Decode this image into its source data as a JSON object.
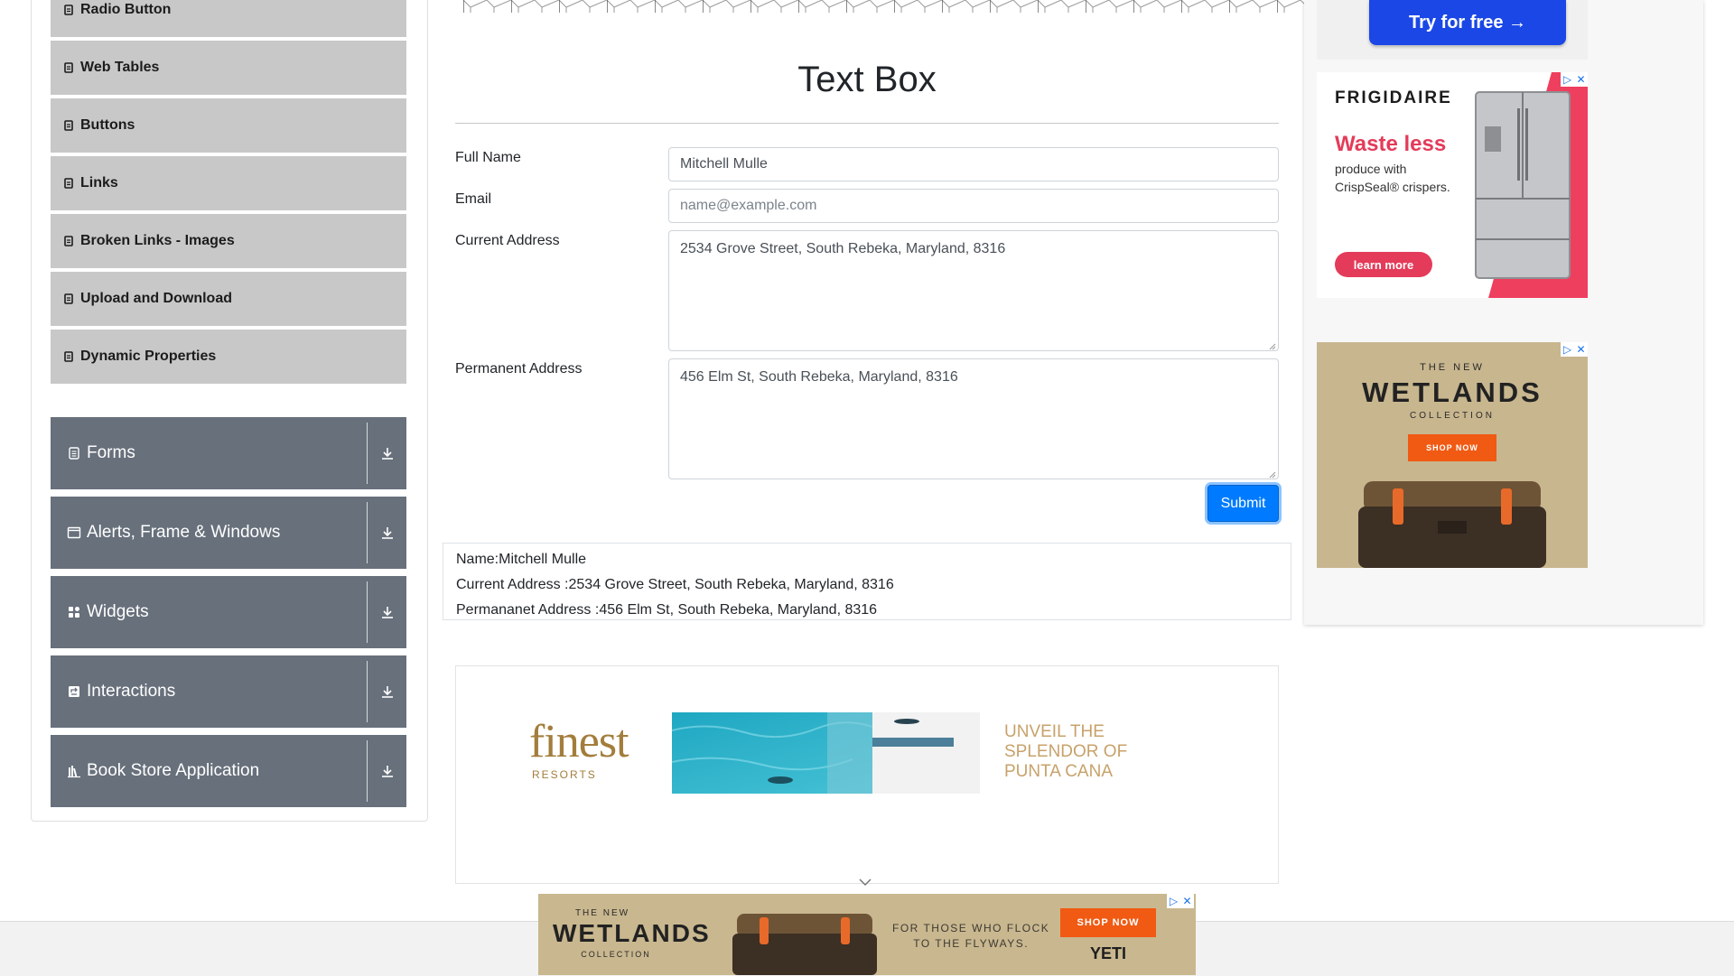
{
  "sidebar": {
    "sub_items": [
      {
        "label": "Radio Button"
      },
      {
        "label": "Web Tables"
      },
      {
        "label": "Buttons"
      },
      {
        "label": "Links"
      },
      {
        "label": "Broken Links - Images"
      },
      {
        "label": "Upload and Download"
      },
      {
        "label": "Dynamic Properties"
      }
    ],
    "groups": [
      {
        "label": "Forms",
        "icon": "form-icon"
      },
      {
        "label": "Alerts, Frame & Windows",
        "icon": "window-icon"
      },
      {
        "label": "Widgets",
        "icon": "widgets-icon"
      },
      {
        "label": "Interactions",
        "icon": "interactions-icon"
      },
      {
        "label": "Book Store Application",
        "icon": "books-icon"
      }
    ]
  },
  "main": {
    "title": "Text Box",
    "fields": {
      "full_name": {
        "label": "Full Name",
        "value": "Mitchell Mulle"
      },
      "email": {
        "label": "Email",
        "value": "",
        "placeholder": "name@example.com"
      },
      "current_address": {
        "label": "Current Address",
        "value": "2534 Grove Street, South Rebeka, Maryland, 8316"
      },
      "permanent_address": {
        "label": "Permanent Address",
        "value": "456 Elm St, South Rebeka, Maryland, 8316"
      }
    },
    "submit_label": "Submit",
    "output": {
      "name": "Name:Mitchell Mulle",
      "current": "Current Address :2534 Grove Street, South Rebeka, Maryland, 8316",
      "permanent": "Permananet Address :456 Elm St, South Rebeka, Maryland, 8316"
    }
  },
  "ads": {
    "top_cta": "Try for free →",
    "frigidaire": {
      "brand": "FRIGIDAIRE",
      "headline": "Waste less",
      "body1": "produce with",
      "body2": "CrispSeal® crispers.",
      "cta": "learn more"
    },
    "wetlands_right": {
      "line1": "THE NEW",
      "line2": "WETLANDS",
      "line3": "COLLECTION",
      "cta": "SHOP NOW"
    },
    "finest": {
      "logo": "finest",
      "sub": "RESORTS",
      "tag1": "UNVEIL THE",
      "tag2": "SPLENDOR OF",
      "tag3": "PUNTA CANA"
    },
    "wetlands_bottom": {
      "line1": "THE NEW",
      "line2": "WETLANDS",
      "line3": "COLLECTION",
      "tag1": "FOR THOSE WHO FLOCK",
      "tag2": "TO THE FLYWAYS.",
      "cta": "SHOP NOW",
      "brand": "YETI"
    }
  },
  "colors": {
    "primary": "#007bff",
    "group_bg": "#67707b",
    "sub_item_bg": "#c8c8c8"
  }
}
